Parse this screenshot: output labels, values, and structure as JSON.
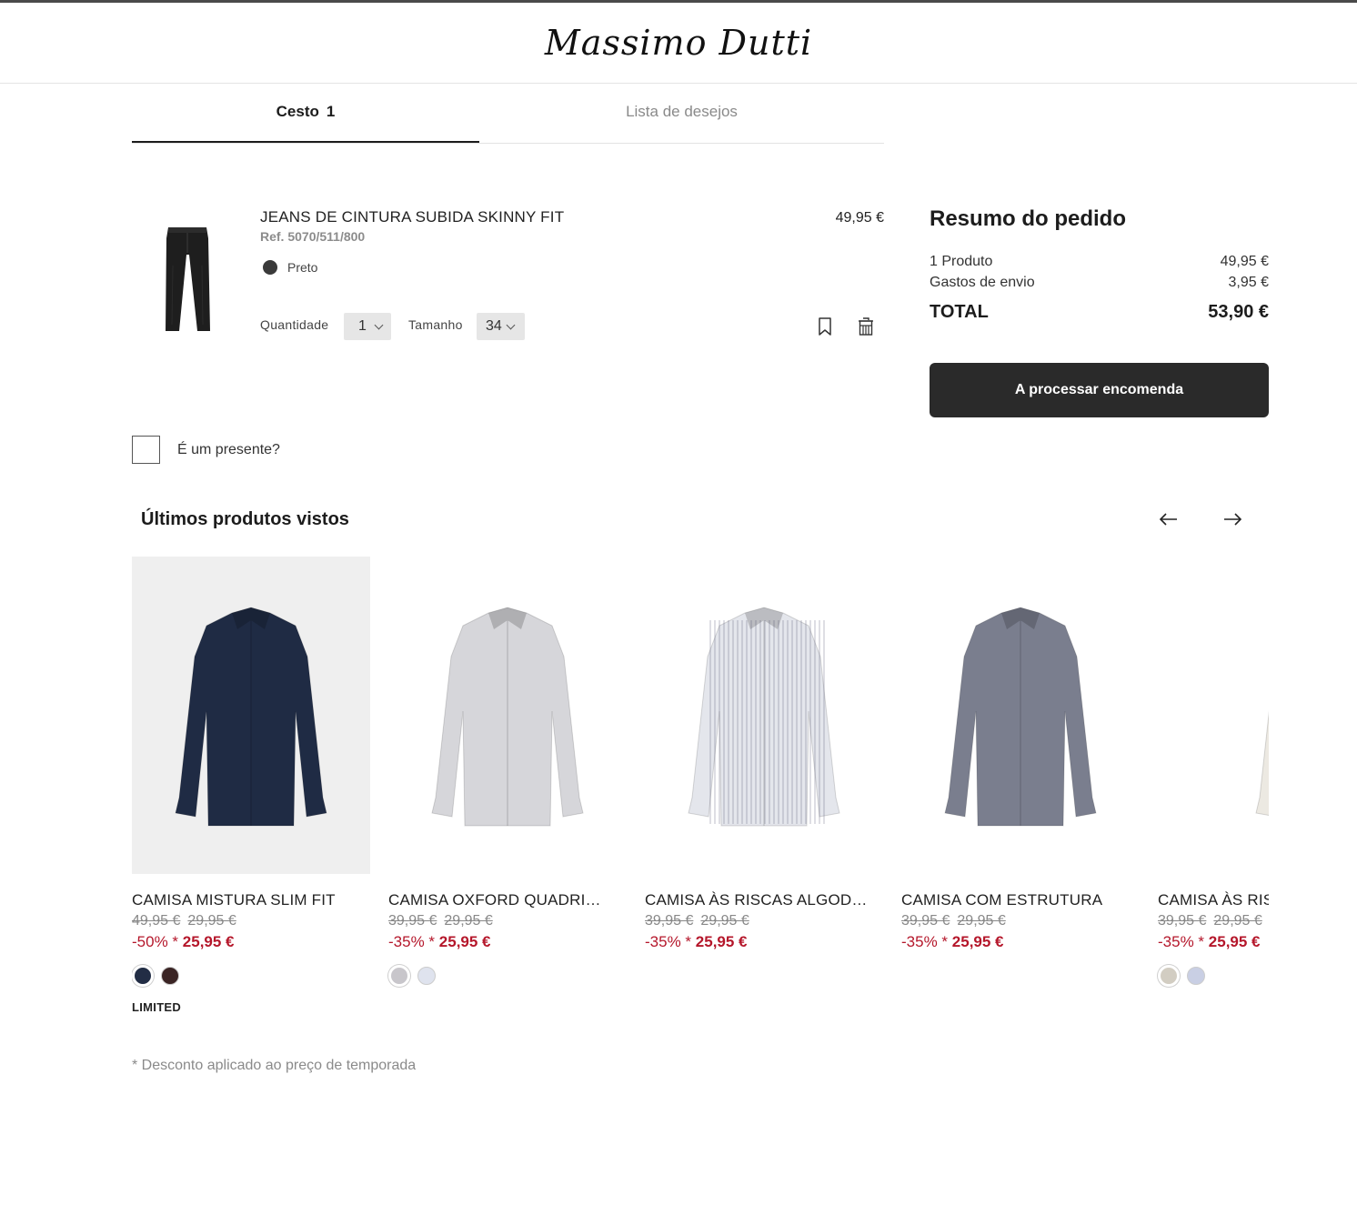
{
  "brand": {
    "name": "Massimo Dutti"
  },
  "tabs": {
    "cart_label": "Cesto",
    "cart_count": "1",
    "wishlist_label": "Lista de desejos"
  },
  "cart_item": {
    "name": "JEANS DE CINTURA SUBIDA SKINNY FIT",
    "ref": "Ref. 5070/511/800",
    "color_name": "Preto",
    "color_hex": "#3a3a3a",
    "price": "49,95 €",
    "quantity_label": "Quantidade",
    "quantity_value": "1",
    "size_label": "Tamanho",
    "size_value": "34",
    "icons": [
      "bookmark-icon",
      "trash-icon"
    ]
  },
  "summary": {
    "title": "Resumo do pedido",
    "products_label": "1 Produto",
    "products_value": "49,95 €",
    "shipping_label": "Gastos de envio",
    "shipping_value": "3,95 €",
    "total_label": "TOTAL",
    "total_value": "53,90 €",
    "checkout_label": "A processar encomenda"
  },
  "gift": {
    "label": "É um presente?"
  },
  "recent": {
    "title": "Últimos produtos vistos",
    "icons": [
      "arrow-left-icon",
      "arrow-right-icon"
    ],
    "products": [
      {
        "name": "CAMISA MISTURA SLIM FIT",
        "old_price": "49,95 €",
        "mid_price": "29,95 €",
        "discount": "-50%",
        "asterisk": "*",
        "sale_price": "25,95 €",
        "swatches": [
          "#222d45",
          "#3a2424"
        ],
        "badge": "LIMITED",
        "shirt_color": "#1f2b44"
      },
      {
        "name": "CAMISA OXFORD QUADRICULADA",
        "old_price": "39,95 €",
        "mid_price": "29,95 €",
        "discount": "-35%",
        "asterisk": "*",
        "sale_price": "25,95 €",
        "swatches": [
          "#c8c6cb",
          "#dfe3ee"
        ],
        "badge": "",
        "shirt_color": "#d6d6da"
      },
      {
        "name": "CAMISA ÀS RISCAS ALGODÃO",
        "old_price": "39,95 €",
        "mid_price": "29,95 €",
        "discount": "-35%",
        "asterisk": "*",
        "sale_price": "25,95 €",
        "swatches": [],
        "badge": "",
        "shirt_color": "#e4e6ec"
      },
      {
        "name": "CAMISA COM ESTRUTURA",
        "old_price": "39,95 €",
        "mid_price": "29,95 €",
        "discount": "-35%",
        "asterisk": "*",
        "sale_price": "25,95 €",
        "swatches": [],
        "badge": "",
        "shirt_color": "#7a7e8e"
      },
      {
        "name": "CAMISA ÀS RISCAS",
        "old_price": "39,95 €",
        "mid_price": "29,95 €",
        "discount": "-35%",
        "asterisk": "*",
        "sale_price": "25,95 €",
        "swatches": [
          "#d2cdc2",
          "#c9cfe4"
        ],
        "badge": "",
        "shirt_color": "#ece9e2"
      }
    ]
  },
  "footnote": "* Desconto aplicado ao preço de temporada",
  "colors": {
    "accent_dark": "#2a2a2a",
    "sale_red": "#b5172b"
  }
}
